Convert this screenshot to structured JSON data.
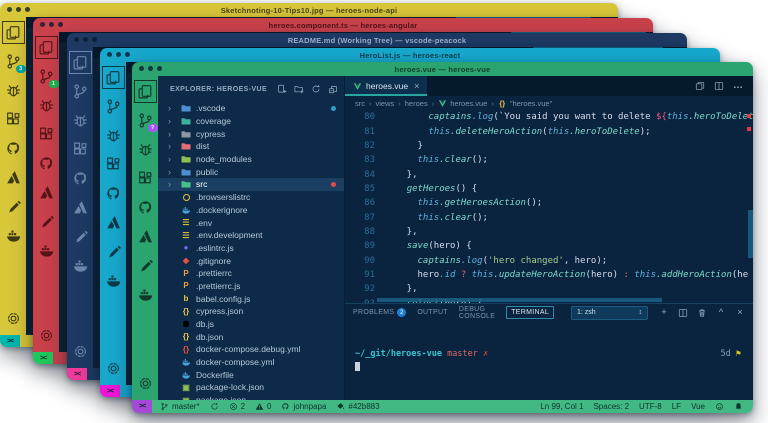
{
  "windows": [
    {
      "title": "Sketchnoting-10-Tips10.jpg — heroes-node-api",
      "accent": "#d9c73a",
      "text_color": "#4a4414",
      "icon_color": "#3e3c12",
      "square": "#00b5ad",
      "badge": "3",
      "badge_color": "#00a79e"
    },
    {
      "title": "heroes.component.ts — heroes-angular",
      "accent": "#c9414b",
      "text_color": "#4d1318",
      "icon_color": "#571419",
      "square": "#1fc75c",
      "badge": "1",
      "badge_color": "#17b84f"
    },
    {
      "title": "README.md (Working Tree) — vscode-peacock",
      "accent": "#1e3a63",
      "text_color": "#9db1cf",
      "icon_color": "#6c88ad",
      "square": "#ee3a9b",
      "badge": "",
      "badge_color": ""
    },
    {
      "title": "HeroList.js — heroes-react",
      "accent": "#17a8cc",
      "text_color": "#0d3d4d",
      "icon_color": "#0b3a49",
      "square": "#f016d9",
      "badge": "",
      "badge_color": ""
    }
  ],
  "front": {
    "title": "heroes.vue — heroes-vue",
    "accent_title": "#2ca470",
    "accent_status": "#42b883",
    "accent_color_hex": "#42b883",
    "square": "#a549d6",
    "badge": "?",
    "badge_color": "#a855f7",
    "explorer": {
      "header": "EXPLORER: HEROES-VUE",
      "actions": [
        "new-file",
        "new-folder",
        "refresh",
        "collapse-all"
      ],
      "items": [
        {
          "label": ".vscode",
          "icon": "folder",
          "color": "#4f8fd0",
          "chevron": true,
          "dot": "#2d9ec7"
        },
        {
          "label": "coverage",
          "icon": "folder",
          "color": "#3bb0a0",
          "chevron": true
        },
        {
          "label": "cypress",
          "icon": "folder",
          "color": "#8a97a5",
          "chevron": true
        },
        {
          "label": "dist",
          "icon": "folder",
          "color": "#e06c75",
          "chevron": true
        },
        {
          "label": "node_modules",
          "icon": "folder",
          "color": "#8cc152",
          "chevron": true
        },
        {
          "label": "public",
          "icon": "folder",
          "color": "#4f8fd0",
          "chevron": true
        },
        {
          "label": "src",
          "icon": "folder",
          "color": "#49c08a",
          "chevron": true,
          "selected": true,
          "dot": "#e34b4b"
        },
        {
          "label": ".browserslistrc",
          "icon": "ring",
          "color": "#e8c545"
        },
        {
          "label": ".dockerignore",
          "icon": "whale",
          "color": "#4aa1d8"
        },
        {
          "label": ".env",
          "icon": "list",
          "color": "#d8b63a"
        },
        {
          "label": ".env.development",
          "icon": "list",
          "color": "#d8b63a"
        },
        {
          "label": ".eslintrc.js",
          "icon": "circle",
          "color": "#7b68ee"
        },
        {
          "label": ".gitignore",
          "icon": "diamond",
          "color": "#e8533f"
        },
        {
          "label": ".prettierrc",
          "icon": "P",
          "color": "#e8a33d"
        },
        {
          "label": ".prettierrc.js",
          "icon": "P",
          "color": "#e8a33d"
        },
        {
          "label": "babel.config.js",
          "icon": "b",
          "color": "#e8c545"
        },
        {
          "label": "cypress.json",
          "icon": "braces",
          "color": "#e8c545"
        },
        {
          "label": "db.js",
          "icon": "db",
          "color": "#e8c545"
        },
        {
          "label": "db.json",
          "icon": "braces",
          "color": "#e8c545"
        },
        {
          "label": "docker-compose.debug.yml",
          "icon": "braces",
          "color": "#e8533f"
        },
        {
          "label": "docker-compose.yml",
          "icon": "whale",
          "color": "#4aa1d8"
        },
        {
          "label": "Dockerfile",
          "icon": "whale",
          "color": "#4aa1d8"
        },
        {
          "label": "package-lock.json",
          "icon": "pkg",
          "color": "#8cc152"
        },
        {
          "label": "package.json",
          "icon": "pkg",
          "color": "#8cc152"
        }
      ]
    },
    "editor": {
      "tab_label": "heroes.vue",
      "tab_close": "×",
      "breadcrumbs": [
        {
          "label": "src"
        },
        {
          "label": "views"
        },
        {
          "label": "heroes"
        },
        {
          "icon": "vue",
          "label": "heroes.vue"
        },
        {
          "icon": "braces-crumb",
          "label": "\"heroes.vue\""
        }
      ],
      "lines": [
        {
          "n": 80,
          "tokens": [
            [
              "c0",
              "        "
            ],
            [
              "c2",
              "captains"
            ],
            [
              "c1",
              ".log"
            ],
            [
              "c0",
              "(`You said you want to delete "
            ],
            [
              "c4",
              "${"
            ],
            [
              "c1",
              "this"
            ],
            [
              "c2",
              ".heroToDelete"
            ]
          ]
        },
        {
          "n": 81,
          "tokens": [
            [
              "c0",
              "        "
            ],
            [
              "c1",
              "this"
            ],
            [
              "c2",
              ".deleteHeroAction"
            ],
            [
              "c0",
              "("
            ],
            [
              "c1",
              "this"
            ],
            [
              "c2",
              ".heroToDelete"
            ],
            [
              "c0",
              ");"
            ]
          ]
        },
        {
          "n": 82,
          "tokens": [
            [
              "c0",
              "      }"
            ]
          ]
        },
        {
          "n": 83,
          "tokens": [
            [
              "c0",
              "      "
            ],
            [
              "c1",
              "this"
            ],
            [
              "c2",
              ".clear"
            ],
            [
              "c0",
              "();"
            ]
          ]
        },
        {
          "n": 84,
          "tokens": [
            [
              "c0",
              "    },"
            ]
          ]
        },
        {
          "n": 85,
          "tokens": [
            [
              "c0",
              "    "
            ],
            [
              "c2",
              "getHeroes"
            ],
            [
              "c0",
              "() {"
            ]
          ]
        },
        {
          "n": 86,
          "tokens": [
            [
              "c0",
              "      "
            ],
            [
              "c1",
              "this"
            ],
            [
              "c2",
              ".getHeroesAction"
            ],
            [
              "c0",
              "();"
            ]
          ]
        },
        {
          "n": 87,
          "tokens": [
            [
              "c0",
              "      "
            ],
            [
              "c1",
              "this"
            ],
            [
              "c2",
              ".clear"
            ],
            [
              "c0",
              "();"
            ]
          ]
        },
        {
          "n": 88,
          "tokens": [
            [
              "c0",
              "    },"
            ]
          ]
        },
        {
          "n": 89,
          "tokens": [
            [
              "c0",
              "    "
            ],
            [
              "c2",
              "save"
            ],
            [
              "c0",
              "(hero) {"
            ]
          ]
        },
        {
          "n": 90,
          "tokens": [
            [
              "c0",
              "      "
            ],
            [
              "c2",
              "captains"
            ],
            [
              "c1",
              ".log"
            ],
            [
              "c0",
              "("
            ],
            [
              "c3",
              "'hero changed'"
            ],
            [
              "c0",
              ", hero);"
            ]
          ]
        },
        {
          "n": 91,
          "tokens": [
            [
              "c0",
              "      hero"
            ],
            [
              "c1",
              ".id"
            ],
            [
              "c0",
              " "
            ],
            [
              "c4",
              "?"
            ],
            [
              "c0",
              " "
            ],
            [
              "c1",
              "this"
            ],
            [
              "c2",
              ".updateHeroAction"
            ],
            [
              "c0",
              "(hero) "
            ],
            [
              "c4",
              ":"
            ],
            [
              "c0",
              " "
            ],
            [
              "c1",
              "this"
            ],
            [
              "c2",
              ".addHeroAction"
            ],
            [
              "c0",
              "(he"
            ]
          ]
        },
        {
          "n": 92,
          "tokens": [
            [
              "c0",
              "    },"
            ]
          ]
        },
        {
          "n": 93,
          "tokens": [
            [
              "c0",
              "    "
            ],
            [
              "c2",
              "select"
            ],
            [
              "c0",
              "(hero) {"
            ]
          ]
        }
      ]
    },
    "panel": {
      "tabs": [
        {
          "label": "PROBLEMS",
          "badge": "2"
        },
        {
          "label": "OUTPUT"
        },
        {
          "label": "DEBUG CONSOLE"
        },
        {
          "label": "TERMINAL",
          "active": true
        }
      ],
      "terminal_select": "1: zsh",
      "terminal": {
        "path": "~/_git/heroes-vue",
        "branch": "master",
        "dirty_mark": "✗",
        "right_text": "5d",
        "flag": "⚑"
      }
    },
    "status": {
      "left": [
        {
          "icon": "branch",
          "text": "master*"
        },
        {
          "icon": "sync",
          "text": ""
        },
        {
          "icon": "error",
          "text": "2"
        },
        {
          "icon": "warning",
          "text": "0"
        },
        {
          "icon": "github",
          "text": "johnpapa"
        },
        {
          "icon": "paint",
          "text": "#42b883"
        }
      ],
      "right": [
        {
          "text": "Ln 99, Col 1"
        },
        {
          "text": "Spaces: 2"
        },
        {
          "text": "UTF-8"
        },
        {
          "text": "LF"
        },
        {
          "text": "Vue"
        },
        {
          "icon": "smiley",
          "text": ""
        },
        {
          "icon": "bell",
          "text": ""
        }
      ]
    }
  }
}
